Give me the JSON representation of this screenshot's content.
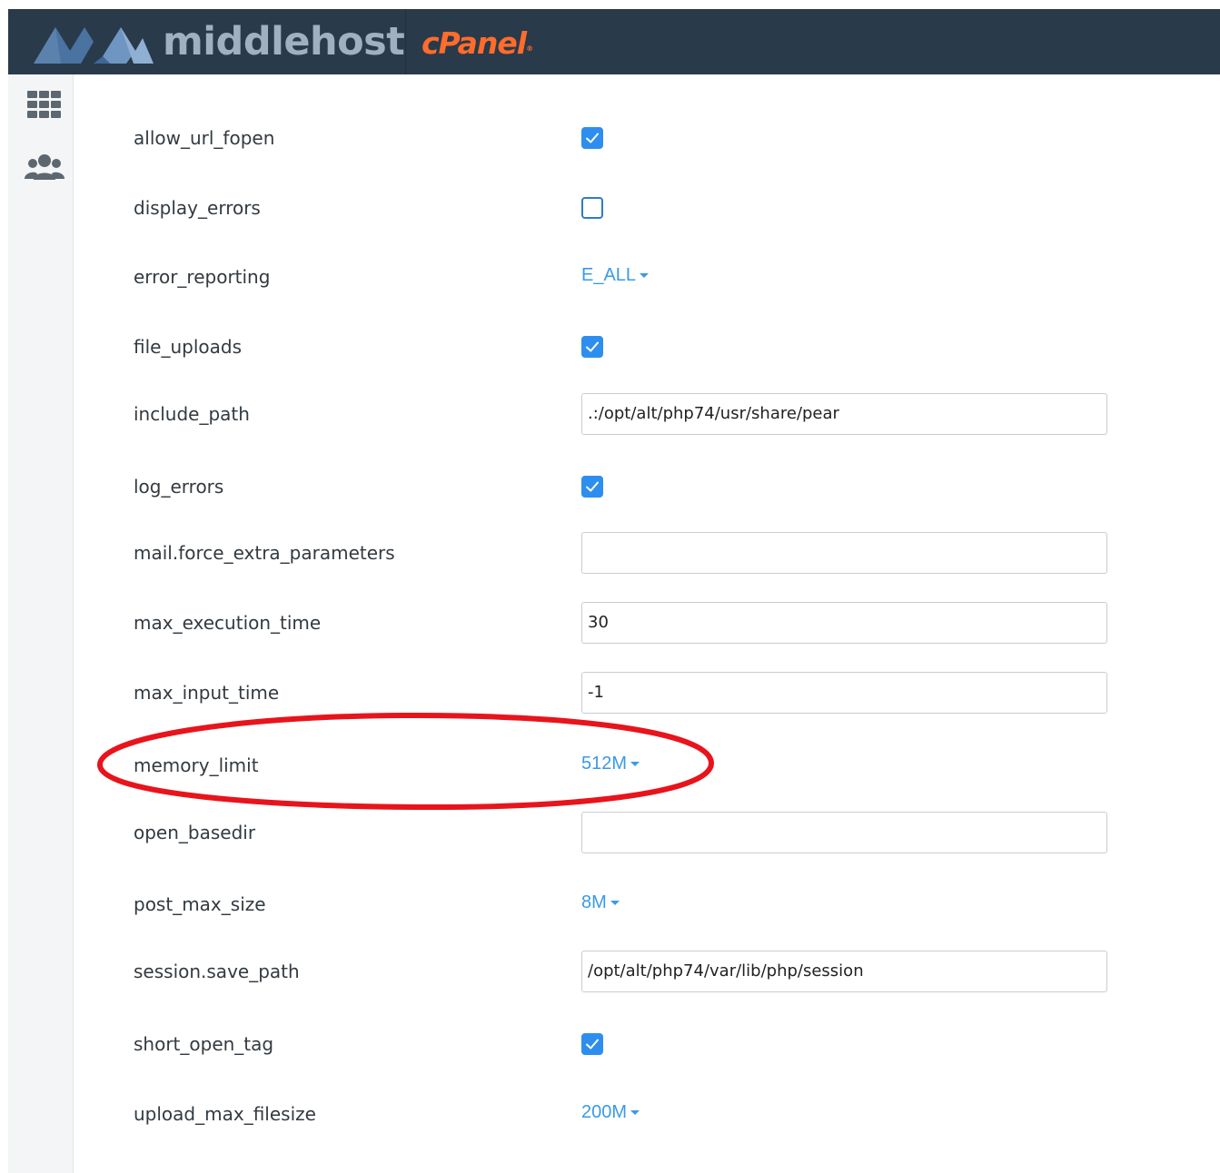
{
  "header": {
    "brand": "middlehost",
    "product": "cPanel",
    "product_mark": "®"
  },
  "sidebar": {
    "items": [
      {
        "icon": "grid-icon",
        "name": "tools"
      },
      {
        "icon": "users-icon",
        "name": "users"
      }
    ]
  },
  "settings": [
    {
      "key": "allow_url_fopen",
      "type": "checkbox",
      "checked": true
    },
    {
      "key": "display_errors",
      "type": "checkbox",
      "checked": false
    },
    {
      "key": "error_reporting",
      "type": "dropdown",
      "value": "E_ALL"
    },
    {
      "key": "file_uploads",
      "type": "checkbox",
      "checked": true
    },
    {
      "key": "include_path",
      "type": "text",
      "value": ".:/opt/alt/php74/usr/share/pear"
    },
    {
      "key": "log_errors",
      "type": "checkbox",
      "checked": true
    },
    {
      "key": "mail.force_extra_parameters",
      "type": "text",
      "value": ""
    },
    {
      "key": "max_execution_time",
      "type": "text",
      "value": "30"
    },
    {
      "key": "max_input_time",
      "type": "text",
      "value": "-1"
    },
    {
      "key": "memory_limit",
      "type": "dropdown",
      "value": "512M",
      "annotated": true
    },
    {
      "key": "open_basedir",
      "type": "text",
      "value": ""
    },
    {
      "key": "post_max_size",
      "type": "dropdown",
      "value": "8M"
    },
    {
      "key": "session.save_path",
      "type": "text",
      "value": "/opt/alt/php74/var/lib/php/session"
    },
    {
      "key": "short_open_tag",
      "type": "checkbox",
      "checked": true
    },
    {
      "key": "upload_max_filesize",
      "type": "dropdown",
      "value": "200M"
    }
  ],
  "colors": {
    "header_bg": "#293a4a",
    "brand_text": "#9fb0c1",
    "cpanel_orange": "#ff6c2c",
    "link_blue": "#3a9ae8",
    "checkbox_blue": "#2d8ef0",
    "annotation_red": "#e8141c"
  }
}
